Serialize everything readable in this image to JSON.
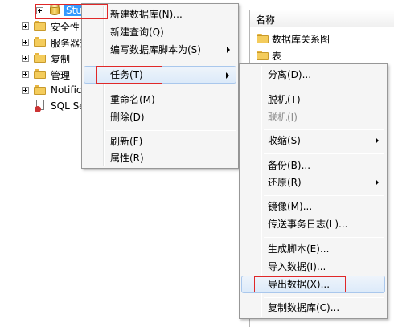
{
  "tree": {
    "items": [
      {
        "label": "Stu",
        "icon": "database-icon"
      },
      {
        "label": "安全性",
        "icon": "folder-icon"
      },
      {
        "label": "服务器对",
        "icon": "folder-icon"
      },
      {
        "label": "复制",
        "icon": "folder-icon"
      },
      {
        "label": "管理",
        "icon": "folder-icon"
      },
      {
        "label": "Notific",
        "icon": "folder-icon"
      },
      {
        "label": "SQL Se",
        "icon": "sql-agent-icon"
      }
    ]
  },
  "menu1": {
    "items": [
      {
        "label": "新建数据库(N)..."
      },
      {
        "label": "新建查询(Q)"
      },
      {
        "label": "编写数据库脚本为(S)"
      },
      {
        "label": "任务(T)"
      },
      {
        "label": "重命名(M)"
      },
      {
        "label": "删除(D)"
      },
      {
        "label": "刷新(F)"
      },
      {
        "label": "属性(R)"
      }
    ]
  },
  "menu2": {
    "items": [
      {
        "label": "分离(D)..."
      },
      {
        "label": "脱机(T)"
      },
      {
        "label": "联机(I)"
      },
      {
        "label": "收缩(S)"
      },
      {
        "label": "备份(B)..."
      },
      {
        "label": "还原(R)"
      },
      {
        "label": "镜像(M)..."
      },
      {
        "label": "传送事务日志(L)..."
      },
      {
        "label": "生成脚本(E)..."
      },
      {
        "label": "导入数据(I)..."
      },
      {
        "label": "导出数据(X)..."
      },
      {
        "label": "复制数据库(C)..."
      }
    ]
  },
  "list": {
    "header": "名称",
    "items": [
      {
        "label": "数据库关系图"
      },
      {
        "label": "表"
      }
    ]
  },
  "colors": {
    "highlight_frame": "#e02828",
    "menu_background": "#f5f5f5",
    "hover_border": "#a9c7ec"
  }
}
